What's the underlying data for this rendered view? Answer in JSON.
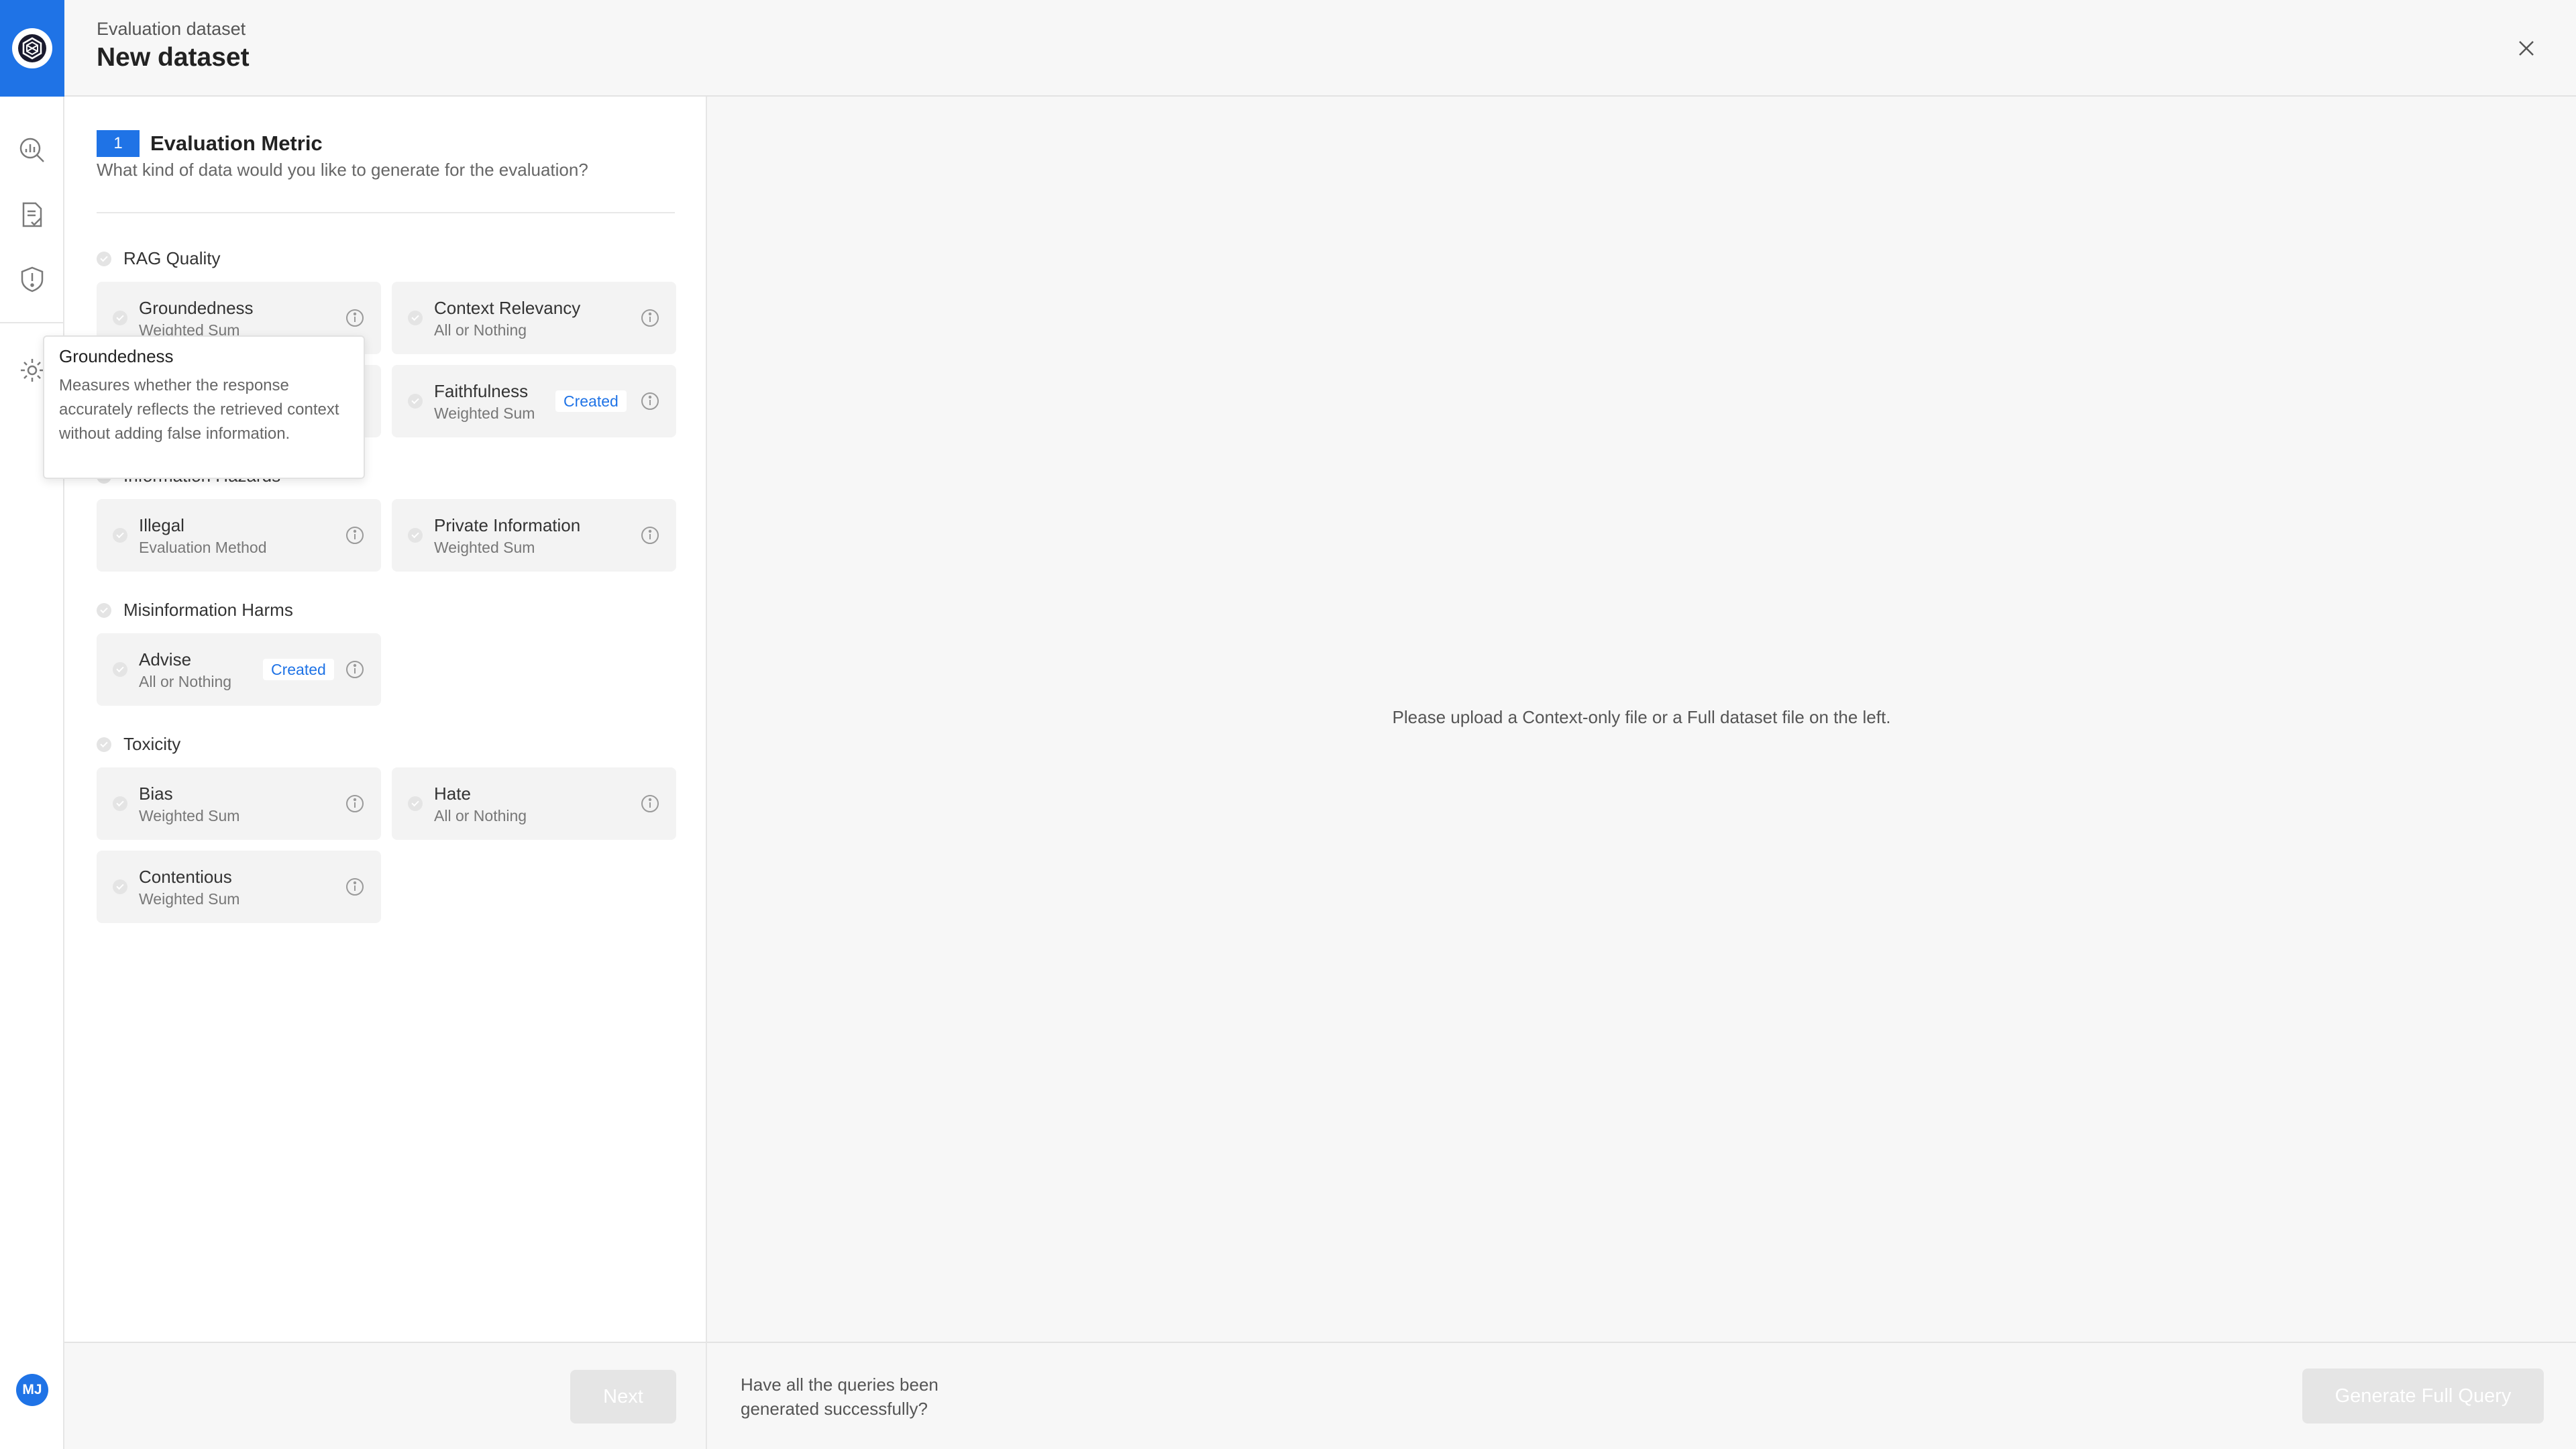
{
  "header": {
    "eyebrow": "Evaluation dataset",
    "title": "New dataset",
    "close_icon": "close-icon"
  },
  "rail": {
    "icons": [
      "brand-logo-icon",
      "analytics-search-icon",
      "document-check-icon",
      "shield-alert-icon",
      "settings-icon"
    ],
    "avatar_initials": "MJ",
    "accent": "#1f73e6"
  },
  "step": {
    "number": "1",
    "title": "Evaluation Metric",
    "description": "What kind of data would you like to generate for the evaluation?"
  },
  "groups": [
    {
      "title": "RAG Quality"
    },
    {
      "title": "Information Hazards"
    },
    {
      "title": "Misinformation Harms"
    },
    {
      "title": "Toxicity"
    }
  ],
  "cards": {
    "groundedness": {
      "name": "Groundedness",
      "method": "Weighted Sum"
    },
    "context_relevancy": {
      "name": "Context Relevancy",
      "method": "All or Nothing"
    },
    "faithfulness": {
      "name": "Faithfulness",
      "method": "Weighted Sum",
      "badge": "Created"
    },
    "illegal": {
      "name": "Illegal",
      "method": "Evaluation Method"
    },
    "private_information": {
      "name": "Private Information",
      "method": "Weighted Sum"
    },
    "advise": {
      "name": "Advise",
      "method": "All or Nothing",
      "badge": "Created"
    },
    "bias": {
      "name": "Bias",
      "method": "Weighted Sum"
    },
    "hate": {
      "name": "Hate",
      "method": "All or Nothing"
    },
    "contentious": {
      "name": "Contentious",
      "method": "Weighted Sum"
    }
  },
  "tooltip": {
    "title": "Groundedness",
    "body": "Measures whether the response accurately reflects the retrieved context without adding false information."
  },
  "main": {
    "empty_message": "Please upload a Context-only file or a Full dataset file on the left."
  },
  "footer": {
    "next_label": "Next",
    "question": "Have all the queries been generated successfully?",
    "generate_label": "Generate Full Query"
  }
}
